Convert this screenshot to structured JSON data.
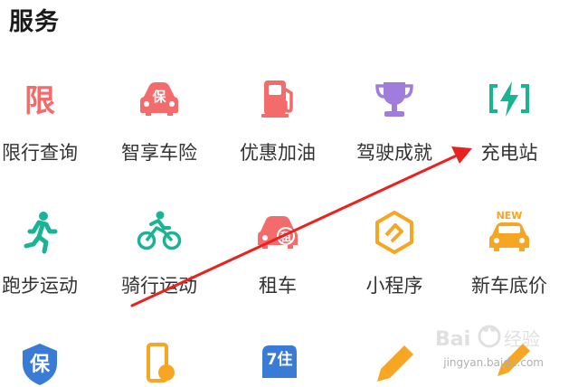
{
  "section": {
    "title": "服务"
  },
  "services": [
    {
      "label": "限行查询",
      "icon": "restriction-icon",
      "color": "#f46b6b"
    },
    {
      "label": "智享车险",
      "icon": "car-insurance-icon",
      "color": "#f46b6b"
    },
    {
      "label": "优惠加油",
      "icon": "fuel-pump-icon",
      "color": "#f46b6b"
    },
    {
      "label": "驾驶成就",
      "icon": "trophy-icon",
      "color": "#a07cdc"
    },
    {
      "label": "充电站",
      "icon": "charging-station-icon",
      "color": "#1ab394"
    },
    {
      "label": "跑步运动",
      "icon": "running-icon",
      "color": "#1ab394"
    },
    {
      "label": "骑行运动",
      "icon": "cycling-icon",
      "color": "#1ab394"
    },
    {
      "label": "租车",
      "icon": "car-rental-icon",
      "color": "#f46b6b"
    },
    {
      "label": "小程序",
      "icon": "mini-program-icon",
      "color": "#f6a623"
    },
    {
      "label": "新车底价",
      "icon": "new-car-price-icon",
      "color": "#f6a623",
      "badge": "NEW"
    }
  ],
  "partial_icons": [
    {
      "icon": "insurance-shield-icon",
      "color": "#3a7bd5",
      "glyph": "保"
    },
    {
      "icon": "phone-icon",
      "color": "#f6a623"
    },
    {
      "icon": "map-badge-icon",
      "color": "#3a7bd5",
      "glyph": "7住"
    },
    {
      "icon": "pencil-icon",
      "color": "#f6a623"
    },
    {
      "icon": "pen-icon",
      "color": "#f6a623"
    }
  ],
  "annotation": {
    "color": "#e8231f"
  },
  "watermark": {
    "brand": "Bai",
    "cn": "经验",
    "url": "jingyan.baidu.com"
  }
}
